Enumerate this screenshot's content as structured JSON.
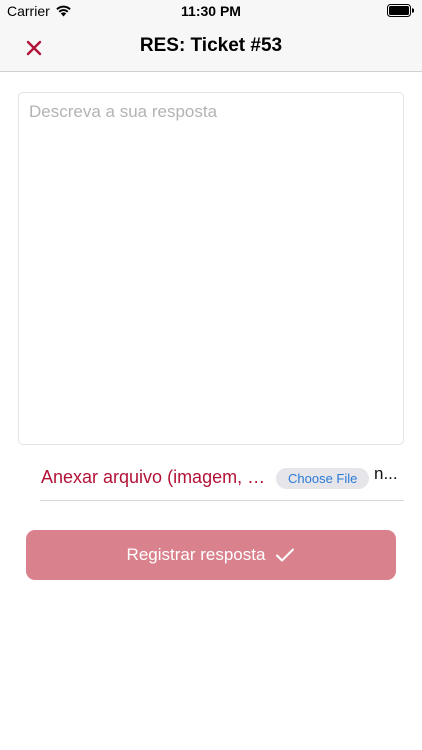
{
  "status_bar": {
    "carrier": "Carrier",
    "time": "11:30 PM",
    "icons": [
      "wifi-icon",
      "battery-icon"
    ]
  },
  "nav": {
    "title": "RES: Ticket #53",
    "close_icon": "close-icon",
    "accent_color": "#b31237"
  },
  "reply": {
    "placeholder": "Descreva a sua resposta",
    "value": ""
  },
  "attachment": {
    "label": "Anexar arquivo (imagem, pdf)",
    "button_label": "Choose File",
    "file_name": "n..."
  },
  "submit": {
    "label": "Registrar resposta",
    "icon": "checkmark-icon",
    "color": "#d9828d"
  }
}
